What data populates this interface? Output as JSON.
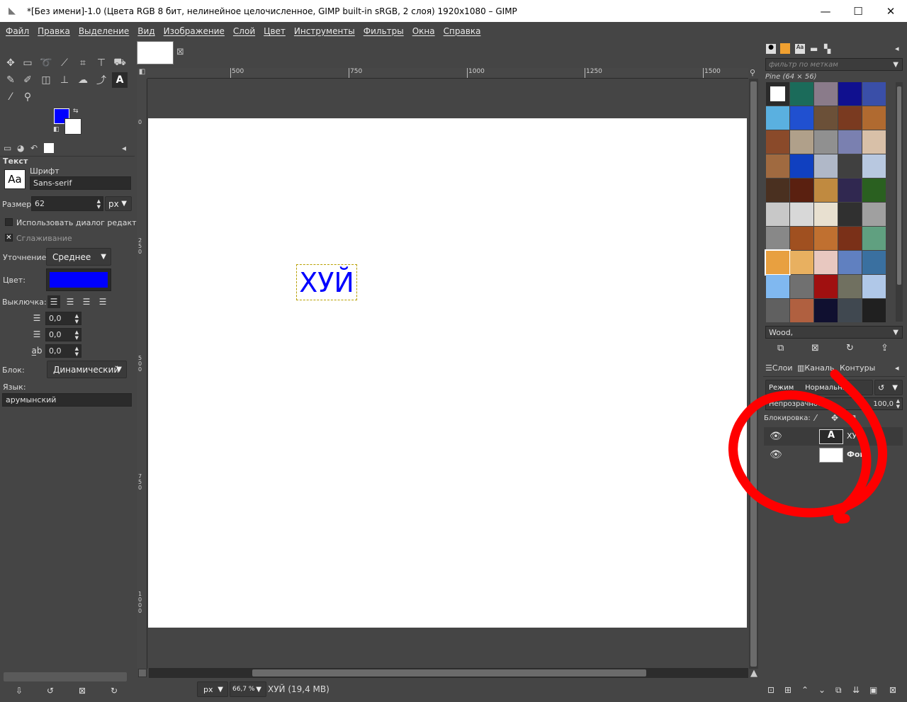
{
  "window": {
    "title": "*[Без имени]-1.0 (Цвета RGB 8 бит, нелинейное целочисленное, GIMP built-in sRGB, 2 слоя) 1920x1080 – GIMP",
    "minimize": "—",
    "maximize": "☐",
    "close": "✕"
  },
  "menu": [
    "Файл",
    "Правка",
    "Выделение",
    "Вид",
    "Изображение",
    "Слой",
    "Цвет",
    "Инструменты",
    "Фильтры",
    "Окна",
    "Справка"
  ],
  "colors": {
    "foreground": "#0000ff",
    "background": "#ffffff",
    "text_color": "#0000ff",
    "annotation": "#ff0000"
  },
  "tool_options": {
    "section": "Текст",
    "font_label": "Шрифт",
    "font_preview": "Aa",
    "font_value": "Sans-serif",
    "size_label": "Размер:",
    "size_value": "62",
    "size_unit": "px",
    "use_editor_label": "Использовать диалог редактор",
    "antialias_label": "Сглаживание",
    "hinting_label": "Уточнение:",
    "hinting_value": "Среднее",
    "color_label": "Цвет:",
    "justify_label": "Выключка:",
    "indent_value": "0,0",
    "line_spacing_value": "0,0",
    "letter_spacing_value": "0,0",
    "box_label": "Блок:",
    "box_value": "Динамический",
    "language_label": "Язык:",
    "language_value": "арумынский"
  },
  "canvas": {
    "ruler_ticks": [
      "500",
      "750",
      "1000",
      "1250",
      "1500"
    ],
    "vruler_ticks": [
      "0",
      "250",
      "500",
      "750",
      "1000"
    ],
    "text_content": "ХУЙ",
    "status_unit": "px",
    "zoom": "66,7 %",
    "status_info": "ХУЙ (19,4 MB)"
  },
  "patterns": {
    "filter_placeholder": "фильтр по меткам",
    "current_pattern": "Pine (64 × 56)",
    "selected_name": "Wood,",
    "swatches": [
      "#ffffff",
      "#1b6b5a",
      "#8a7b8a",
      "#10108f",
      "#3a4fa8",
      "#5ab0e0",
      "#2050d0",
      "#6b5038",
      "#7a3a20",
      "#b06a30",
      "#8a4a2a",
      "#b0a08a",
      "#909090",
      "#7a80b0",
      "#d8c0a8",
      "#a06a40",
      "#1040c0",
      "#b0b8c8",
      "#404040",
      "#b8c8e0",
      "#4a3020",
      "#5a2010",
      "#c08a40",
      "#302850",
      "#2a6020",
      "#c8c8c8",
      "#d8d8d8",
      "#e8e0d0",
      "#303030",
      "#a0a0a0",
      "#888888",
      "#a05020",
      "#c07030",
      "#7a3018",
      "#60a080",
      "#e8a040",
      "#e8b060",
      "#e8c8c0",
      "#6080c0",
      "#3a70a0",
      "#80b8f0",
      "#707070",
      "#a01010",
      "#707060",
      "#b0c8e8",
      "#606060",
      "#b06040",
      "#101030",
      "#404850",
      "#202020"
    ]
  },
  "layers_panel": {
    "tabs": [
      "Слои",
      "Каналы",
      "Контуры"
    ],
    "mode_label": "Режим",
    "mode_value": "Нормальный",
    "opacity_label": "Непрозрачность",
    "opacity_value": "100,0",
    "lock_label": "Блокировка:",
    "layers": [
      {
        "name": "ХУЙ",
        "type": "text"
      },
      {
        "name": "Фон",
        "type": "raster"
      }
    ]
  }
}
